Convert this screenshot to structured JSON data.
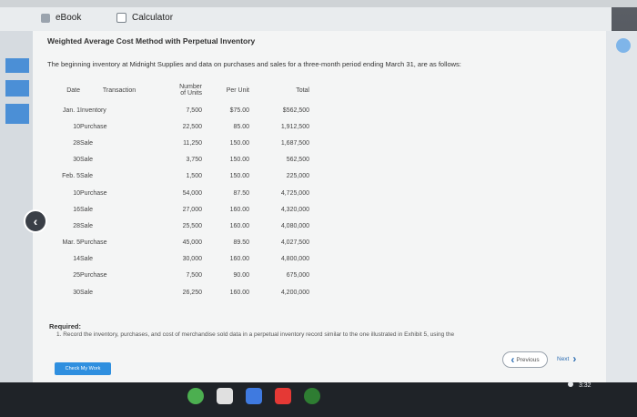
{
  "tabs": [
    {
      "label": "eBook"
    },
    {
      "label": "Calculator"
    }
  ],
  "page": {
    "title": "Weighted Average Cost Method with Perpetual Inventory",
    "intro": "The beginning inventory at Midnight Supplies and data on purchases and sales for a three-month period ending March 31, are as follows:"
  },
  "table": {
    "headers": {
      "date": "Date",
      "transaction": "Transaction",
      "number_line1": "Number",
      "number_line2": "of Units",
      "per_unit": "Per Unit",
      "total": "Total"
    },
    "rows": [
      {
        "date": "Jan. 1",
        "transaction": "Inventory",
        "units": "7,500",
        "per_unit": "$75.00",
        "total": "$562,500"
      },
      {
        "date": "10",
        "transaction": "Purchase",
        "units": "22,500",
        "per_unit": "85.00",
        "total": "1,912,500"
      },
      {
        "date": "28",
        "transaction": "Sale",
        "units": "11,250",
        "per_unit": "150.00",
        "total": "1,687,500"
      },
      {
        "date": "30",
        "transaction": "Sale",
        "units": "3,750",
        "per_unit": "150.00",
        "total": "562,500"
      },
      {
        "date": "Feb. 5",
        "transaction": "Sale",
        "units": "1,500",
        "per_unit": "150.00",
        "total": "225,000"
      },
      {
        "date": "10",
        "transaction": "Purchase",
        "units": "54,000",
        "per_unit": "87.50",
        "total": "4,725,000"
      },
      {
        "date": "16",
        "transaction": "Sale",
        "units": "27,000",
        "per_unit": "160.00",
        "total": "4,320,000"
      },
      {
        "date": "28",
        "transaction": "Sale",
        "units": "25,500",
        "per_unit": "160.00",
        "total": "4,080,000"
      },
      {
        "date": "Mar. 5",
        "transaction": "Purchase",
        "units": "45,000",
        "per_unit": "89.50",
        "total": "4,027,500"
      },
      {
        "date": "14",
        "transaction": "Sale",
        "units": "30,000",
        "per_unit": "160.00",
        "total": "4,800,000"
      },
      {
        "date": "25",
        "transaction": "Purchase",
        "units": "7,500",
        "per_unit": "90.00",
        "total": "675,000"
      },
      {
        "date": "30",
        "transaction": "Sale",
        "units": "26,250",
        "per_unit": "160.00",
        "total": "4,200,000"
      }
    ]
  },
  "required": {
    "label": "Required:",
    "item1": "1. Record the inventory, purchases, and cost of merchandise sold data in a perpetual inventory record similar to the one illustrated in Exhibit 5, using the"
  },
  "nav": {
    "previous": "Previous",
    "next": "Next"
  },
  "check_button": "Check My Work",
  "status": {
    "time": "3:32"
  },
  "colors": {
    "accent": "#2f8fdf",
    "link": "#2f6fb3"
  }
}
